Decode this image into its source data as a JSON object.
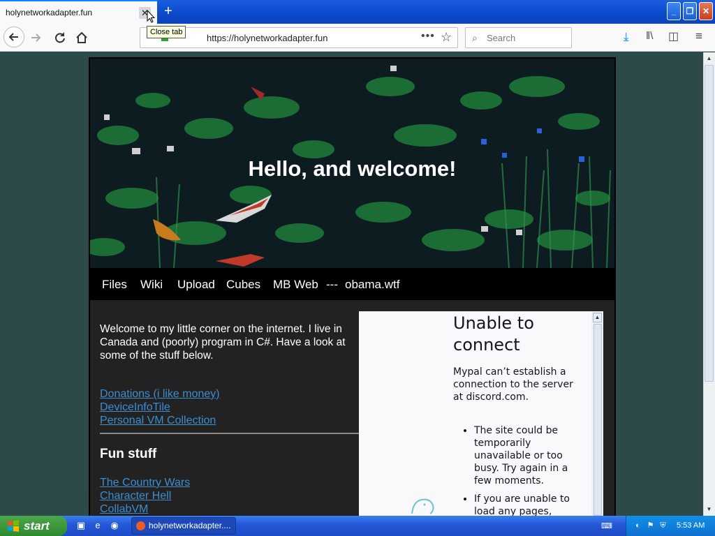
{
  "browser": {
    "tab_title": "holynetworkadapter.fun",
    "tab_close_glyph": "✕",
    "new_tab_glyph": "+",
    "tooltip": "Close tab",
    "url": "https://holynetworkadapter.fun",
    "page_actions_glyph": "•••",
    "bookmark_glyph": "☆",
    "search_placeholder": "Search",
    "icons": [
      "back-icon",
      "forward-icon",
      "reload-icon",
      "home-icon",
      "download-icon",
      "library-icon",
      "sidebar-icon",
      "menu-icon"
    ]
  },
  "window": {
    "minimize": "_",
    "maximize": "❐",
    "close": "✕"
  },
  "page": {
    "hero_title": "Hello, and welcome!",
    "menu": [
      "Files",
      "Wiki",
      "Upload",
      "Cubes",
      "MB Web",
      "---",
      "obama.wtf"
    ],
    "intro": "Welcome to my little corner on the internet. I live in Canada and (poorly) program in C#. Have a look at some of the stuff below.",
    "links": [
      "Donations (i like money)",
      "DeviceInfoTile",
      "Personal VM Collection"
    ],
    "fun_heading": "Fun stuff",
    "fun_links": [
      "The Country Wars",
      "Character Hell",
      "CollabVM"
    ]
  },
  "embed_error": {
    "title": "Unable to connect",
    "description": "Mypal can’t establish a connection to the server at discord.com.",
    "bullets": [
      "The site could be temporarily unavailable or too busy. Try again in a few moments.",
      "If you are unable to load any pages,"
    ]
  },
  "taskbar": {
    "start_label": "start",
    "task_button": "holynetworkadapter....",
    "clock": "5:53 AM"
  }
}
